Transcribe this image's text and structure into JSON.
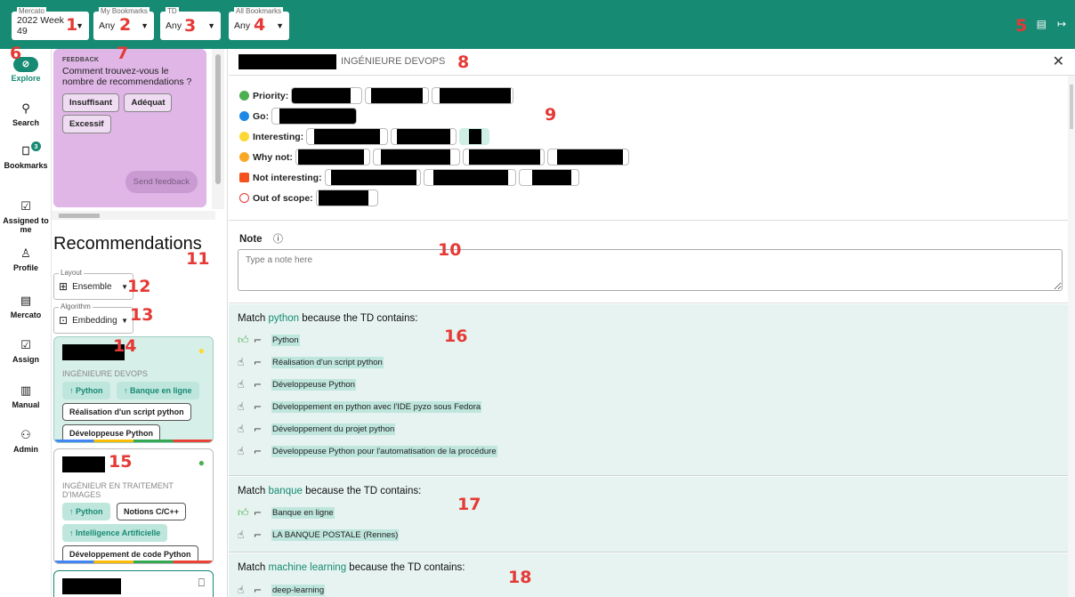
{
  "topbar": {
    "filters": [
      {
        "label": "Mercato",
        "value": "2022 Week 49"
      },
      {
        "label": "My Bookmarks",
        "value": "Any"
      },
      {
        "label": "TD",
        "value": "Any"
      },
      {
        "label": "All Bookmarks",
        "value": "Any"
      }
    ],
    "icons": [
      "table-icon",
      "logout-icon"
    ]
  },
  "nav": {
    "items": [
      {
        "label": "Explore",
        "icon": "compass-icon",
        "active": true
      },
      {
        "label": "Search",
        "icon": "search-icon"
      },
      {
        "label": "Bookmarks",
        "icon": "bookmark-icon",
        "badge": "3"
      },
      {
        "label": "Assigned to me",
        "icon": "checkbox-icon"
      },
      {
        "label": "Profile",
        "icon": "person-icon"
      },
      {
        "label": "Mercato",
        "icon": "list-icon"
      },
      {
        "label": "Assign",
        "icon": "checkbox-icon"
      },
      {
        "label": "Manual",
        "icon": "book-icon"
      },
      {
        "label": "Admin",
        "icon": "admin-icon"
      }
    ]
  },
  "feedback": {
    "title": "FEEDBACK",
    "question": "Comment trouvez-vous le nombre de recommendations ?",
    "options": [
      "Insuffisant",
      "Adéquat",
      "Excessif"
    ],
    "send": "Send feedback"
  },
  "recommendations": {
    "title": "Recommendations",
    "layout": {
      "label": "Layout",
      "value": "Ensemble"
    },
    "algorithm": {
      "label": "Algorithm",
      "value": "Embedding"
    },
    "cards": [
      {
        "subtitle": "INGÉNIEURE DEVOPS",
        "tags": [
          "Python",
          "Banque en ligne"
        ],
        "plain_tags": [
          "Réalisation d'un script python",
          "Développeuse Python"
        ]
      },
      {
        "subtitle": "INGÉNIEUR EN TRAITEMENT D'IMAGES",
        "tags": [
          "Python"
        ],
        "tags_b": [
          "Intelligence Artificielle"
        ],
        "plain_tags": [
          "Notions C/C++",
          "Développement de code Python"
        ]
      }
    ]
  },
  "detail": {
    "profile_title": "INGÉNIEURE DEVOPS",
    "rank": [
      {
        "label": "Priority:",
        "color": "#4caf50"
      },
      {
        "label": "Go:",
        "color": "#1e88e5"
      },
      {
        "label": "Interesting:",
        "color": "#fdd835"
      },
      {
        "label": "Why not:",
        "color": "#f9a825"
      },
      {
        "label": "Not interesting:",
        "color": "#f4511e"
      },
      {
        "label": "Out of scope:",
        "color": "#e53935"
      }
    ],
    "note": {
      "label": "Note",
      "placeholder": "Type a note here"
    },
    "matches": [
      {
        "prefix": "Match ",
        "keyword": "python",
        "suffix": " because the TD contains:",
        "items": [
          "Python",
          "Réalisation d'un script python",
          "Développeuse Python",
          "Développement en python avec l'IDE pyzo sous Fedora",
          "Développement du projet python",
          "Développeuse Python pour l'automatisation de la procédure"
        ]
      },
      {
        "prefix": "Match ",
        "keyword": "banque",
        "suffix": " because the TD contains:",
        "items": [
          "Banque en ligne",
          "LA BANQUE POSTALE (Rennes)"
        ]
      },
      {
        "prefix": "Match ",
        "keyword": "machine learning",
        "suffix": " because the TD contains:",
        "items": [
          "deep-learning"
        ]
      }
    ]
  },
  "markers": [
    "1",
    "2",
    "3",
    "4",
    "5",
    "6",
    "7",
    "8",
    "9",
    "10",
    "11",
    "12",
    "13",
    "14",
    "15",
    "16",
    "17",
    "18"
  ]
}
